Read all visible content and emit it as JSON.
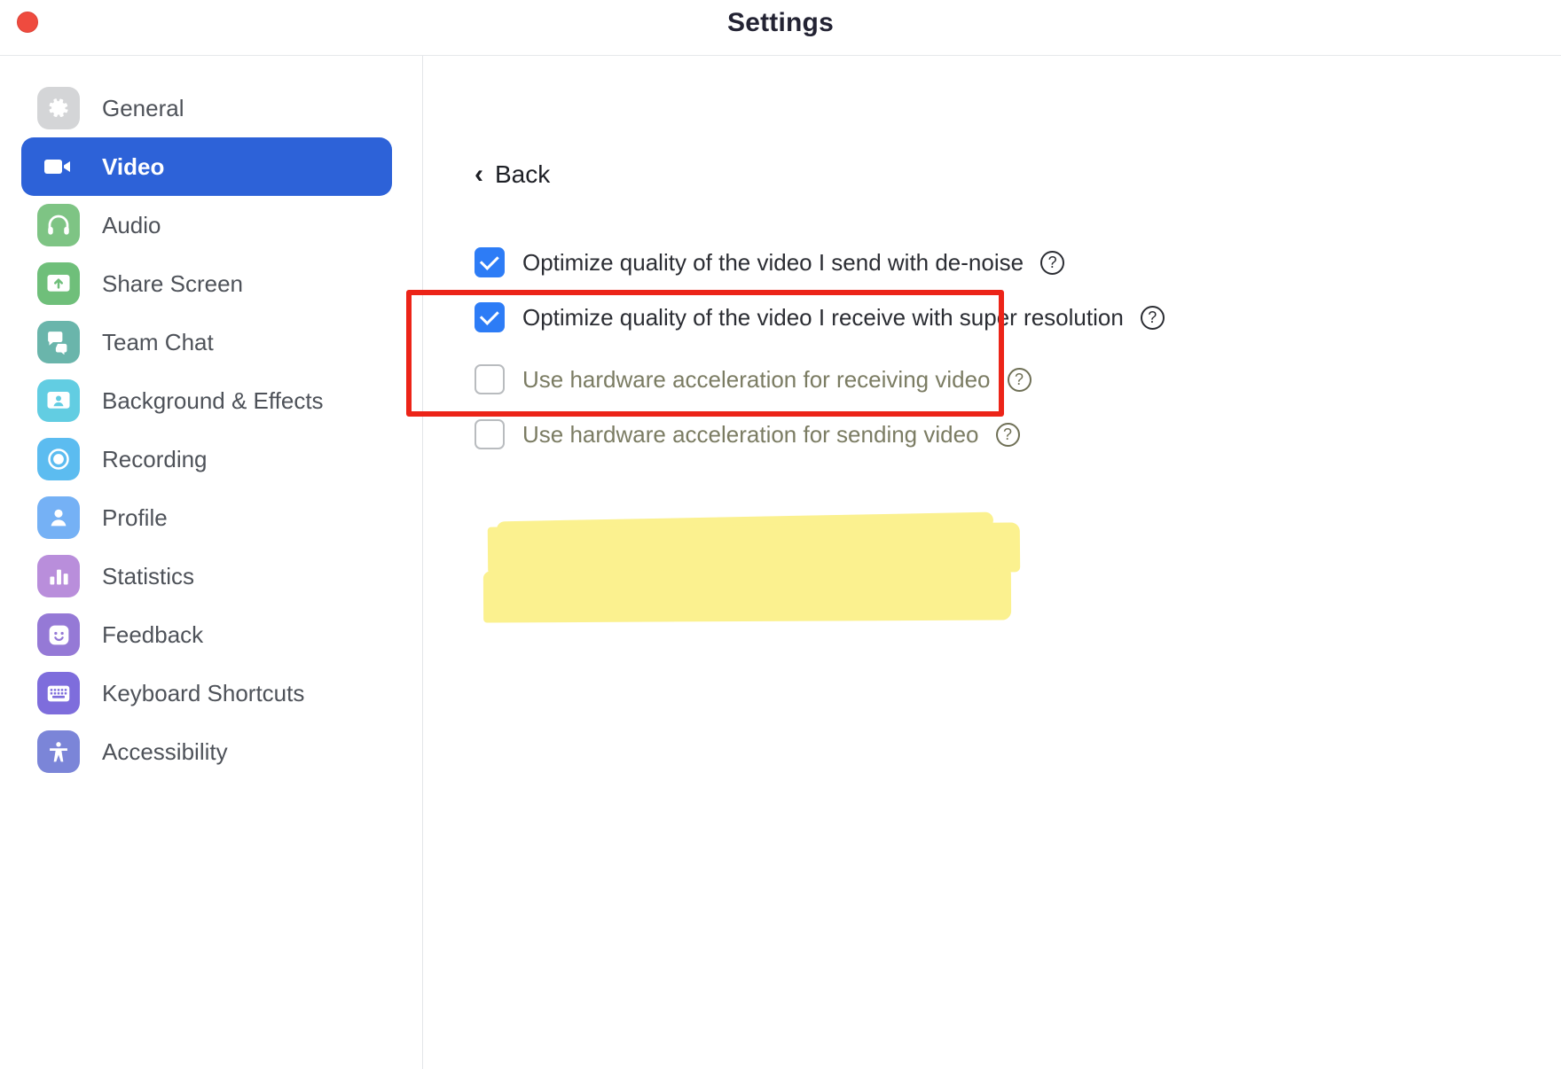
{
  "window": {
    "title": "Settings",
    "close_button": "close"
  },
  "sidebar": {
    "items": [
      {
        "label": "General",
        "icon": "gear-icon",
        "color": "#d4d5d7",
        "active": false
      },
      {
        "label": "Video",
        "icon": "video-camera-icon",
        "color": "#2d62d8",
        "active": true
      },
      {
        "label": "Audio",
        "icon": "headphones-icon",
        "color": "#7ec484",
        "active": false
      },
      {
        "label": "Share Screen",
        "icon": "share-screen-icon",
        "color": "#6fbf7a",
        "active": false
      },
      {
        "label": "Team Chat",
        "icon": "chat-bubble-icon",
        "color": "#6ab5ab",
        "active": false
      },
      {
        "label": "Background & Effects",
        "icon": "background-icon",
        "color": "#62cde2",
        "active": false
      },
      {
        "label": "Recording",
        "icon": "record-icon",
        "color": "#5cbcf0",
        "active": false
      },
      {
        "label": "Profile",
        "icon": "person-icon",
        "color": "#75b1f5",
        "active": false
      },
      {
        "label": "Statistics",
        "icon": "bar-chart-icon",
        "color": "#b98edb",
        "active": false
      },
      {
        "label": "Feedback",
        "icon": "smiley-icon",
        "color": "#9579d6",
        "active": false
      },
      {
        "label": "Keyboard Shortcuts",
        "icon": "keyboard-icon",
        "color": "#7e6ddc",
        "active": false
      },
      {
        "label": "Accessibility",
        "icon": "accessibility-icon",
        "color": "#7b85d8",
        "active": false
      }
    ]
  },
  "main": {
    "back": {
      "label": "Back",
      "chevron": "‹"
    },
    "help_glyph": "?",
    "options": [
      {
        "label": "Optimize quality of the video I send with de-noise",
        "checked": true,
        "dimmed": false,
        "has_help": true
      },
      {
        "label": "Optimize quality of the video I receive with super resolution",
        "checked": true,
        "dimmed": false,
        "has_help": true
      },
      {
        "label": "Use hardware acceleration for receiving video",
        "checked": false,
        "dimmed": true,
        "has_help": true
      },
      {
        "label": "Use hardware acceleration for sending video",
        "checked": false,
        "dimmed": true,
        "has_help": true
      }
    ]
  },
  "annotations": {
    "highlight_color": "#fbf18f",
    "box_color": "#ec2418",
    "highlighted_option_indexes": [
      2,
      3
    ]
  }
}
